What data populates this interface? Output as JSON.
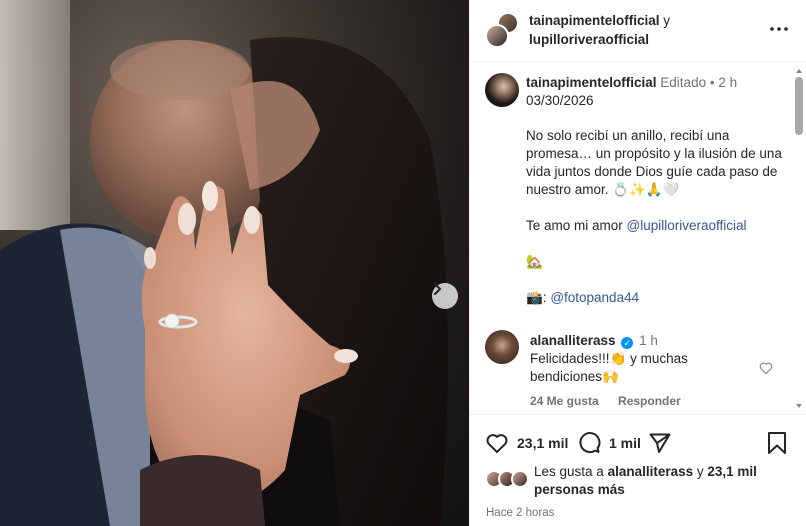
{
  "header": {
    "account_one": "tainapimentelofficial",
    "connector": "y",
    "account_two": "lupilloriveraofficial",
    "more_icon": "more-horizontal-icon"
  },
  "caption": {
    "username": "tainapimentelofficial",
    "edited": "Editado",
    "separator": "•",
    "age": "2 h",
    "date": "03/30/2026",
    "text": "No solo recibí un anillo, recibí una promesa… un propósito y la ilusión de una vida juntos donde Dios guíe cada paso de nuestro amor.",
    "text_emojis": "💍✨🙏🤍",
    "love_line": "Te amo mi amor ",
    "love_mention": "@lupilloriveraofficial",
    "house_emoji": "🏡",
    "camera_emoji": "📸: ",
    "photo_mention": "@fotopanda44"
  },
  "comment": {
    "username": "alanalliterass",
    "age": "1 h",
    "text_a": "Felicidades!!!👏 y muchas bendiciones",
    "text_emoji": "🙌",
    "likes": "24 Me gusta",
    "reply": "Responder"
  },
  "actions": {
    "like_count": "23,1 mil",
    "comment_count": "1 mil",
    "liked_by_prefix": "Les gusta a ",
    "liked_by_user": "alanalliterass",
    "liked_by_suffix": " y ",
    "liked_by_count": "23,1 mil personas más",
    "time_ago": "Hace 2 horas"
  },
  "colors": {
    "accent_link": "#385898",
    "verified_blue": "#0095f6",
    "muted_text": "#737373",
    "border": "#efefef"
  }
}
